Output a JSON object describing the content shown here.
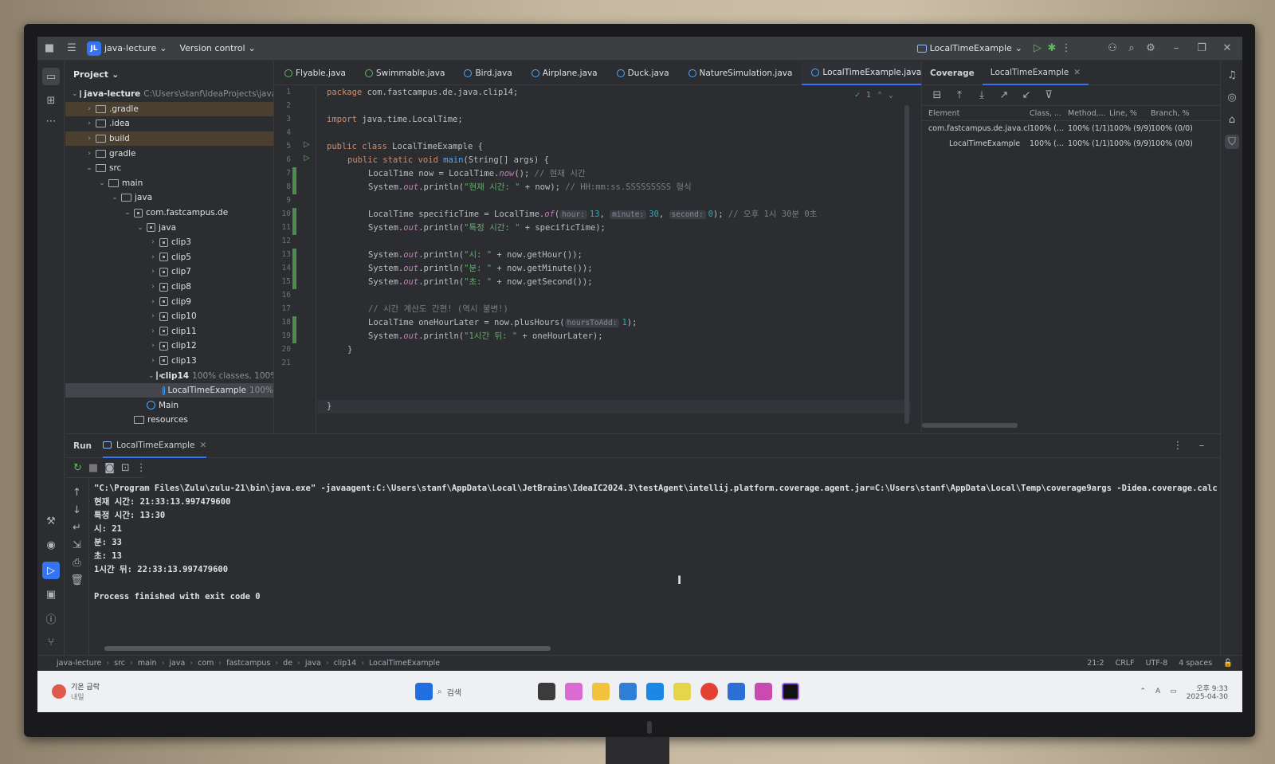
{
  "titlebar": {
    "project_badge": "JL",
    "project": "java-lecture",
    "vcs": "Version control",
    "run_config": "LocalTimeExample"
  },
  "project_panel": {
    "title": "Project",
    "root_name": "java-lecture",
    "root_path": "C:\\Users\\stanf\\IdeaProjects\\java-le",
    "items": [
      {
        "label": ".gradle",
        "note": ""
      },
      {
        "label": ".idea",
        "note": ""
      },
      {
        "label": "build",
        "note": ""
      },
      {
        "label": "gradle",
        "note": ""
      },
      {
        "label": "src",
        "note": ""
      },
      {
        "label": "main",
        "note": ""
      },
      {
        "label": "java",
        "note": ""
      },
      {
        "label": "com.fastcampus.de",
        "note": ""
      },
      {
        "label": "java",
        "note": ""
      },
      {
        "label": "clip3",
        "note": ""
      },
      {
        "label": "clip5",
        "note": ""
      },
      {
        "label": "clip7",
        "note": ""
      },
      {
        "label": "clip8",
        "note": ""
      },
      {
        "label": "clip9",
        "note": ""
      },
      {
        "label": "clip10",
        "note": ""
      },
      {
        "label": "clip11",
        "note": ""
      },
      {
        "label": "clip12",
        "note": ""
      },
      {
        "label": "clip13",
        "note": ""
      },
      {
        "label": "clip14",
        "note": "100% classes, 100% li"
      },
      {
        "label": "LocalTimeExample",
        "note": "100%"
      },
      {
        "label": "Main",
        "note": ""
      },
      {
        "label": "resources",
        "note": ""
      }
    ]
  },
  "editor_tabs": [
    "Flyable.java",
    "Swimmable.java",
    "Bird.java",
    "Airplane.java",
    "Duck.java",
    "NatureSimulation.java",
    "LocalTimeExample.java"
  ],
  "editor": {
    "inspection_count": "1",
    "line_numbers": [
      "1",
      "2",
      "3",
      "4",
      "5",
      "6",
      "7",
      "8",
      "9",
      "10",
      "11",
      "12",
      "13",
      "14",
      "15",
      "16",
      "17",
      "18",
      "19",
      "20",
      "21"
    ],
    "lines": {
      "l1_kw": "package",
      "l1_rest": " com.fastcampus.de.java.clip14;",
      "l3_kw": "import",
      "l3_rest": " java.time.LocalTime;",
      "l5_kw": "public class",
      "l5_rest": " LocalTimeExample {",
      "l6_kw": "public static void",
      "l6_fn": "main",
      "l6_rest": "(String[] args) {",
      "l7_a": "LocalTime now = LocalTime.",
      "l7_st": "now",
      "l7_b": "(); ",
      "l7_cm": "// 현재 시간",
      "l8_a": "System.",
      "l8_st": "out",
      "l8_b": ".println(",
      "l8_str": "\"현재 시간: \"",
      "l8_c": " + now); ",
      "l8_cm": "// HH:mm:ss.SSSSSSSSS 형식",
      "l10_a": "LocalTime specificTime = LocalTime.",
      "l10_st": "of",
      "l10_hint1": "hour:",
      "l10_n1": "13",
      "l10_hint2": "minute:",
      "l10_n2": "30",
      "l10_hint3": "second:",
      "l10_n3": "0",
      "l10_cm": "// 오후 1시 30분 0초",
      "l11_str": "\"특정 시간: \"",
      "l11_c": " + specificTime);",
      "l13_str": "\"시: \"",
      "l13_c": " + now.getHour());",
      "l14_str": "\"분: \"",
      "l14_c": " + now.getMinute());",
      "l15_str": "\"초: \"",
      "l15_c": " + now.getSecond());",
      "l17_cm": "// 시간 계산도 간편! (역시 불변!)",
      "l18_a": "LocalTime oneHourLater = now.plusHours(",
      "l18_hint": "hoursToAdd:",
      "l18_n": "1",
      "l18_b": ");",
      "l19_str": "\"1시간 뒤: \"",
      "l19_c": " + oneHourLater);",
      "l20": "}",
      "l21": "}"
    }
  },
  "coverage": {
    "tab_title": "Coverage",
    "tab_run": "LocalTimeExample",
    "headers": [
      "Element",
      "Class, ...",
      "Method,...",
      "Line, %",
      "Branch, %"
    ],
    "rows": [
      {
        "element": "com.fastcampus.de.java.cl",
        "class": "100% (...",
        "method": "100% (1/1)",
        "line": "100% (9/9)",
        "branch": "100% (0/0)"
      },
      {
        "element": "LocalTimeExample",
        "class": "100% (...",
        "method": "100% (1/1)",
        "line": "100% (9/9)",
        "branch": "100% (0/0)"
      }
    ]
  },
  "run_panel": {
    "title": "Run",
    "tab": "LocalTimeExample",
    "console": [
      "\"C:\\Program Files\\Zulu\\zulu-21\\bin\\java.exe\" -javaagent:C:\\Users\\stanf\\AppData\\Local\\JetBrains\\IdeaIC2024.3\\testAgent\\intellij.platform.coverage.agent.jar=C:\\Users\\stanf\\AppData\\Local\\Temp\\coverage9args -Didea.coverage.calcu",
      "현재 시간: 21:33:13.997479600",
      "특정 시간: 13:30",
      "시: 21",
      "분: 33",
      "초: 13",
      "1시간 뒤: 22:33:13.997479600",
      "",
      "Process finished with exit code 0"
    ]
  },
  "statusbar": {
    "breadcrumb": [
      "java-lecture",
      "src",
      "main",
      "java",
      "com",
      "fastcampus",
      "de",
      "java",
      "clip14",
      "LocalTimeExample"
    ],
    "position": "21:2",
    "line_sep": "CRLF",
    "encoding": "UTF-8",
    "indent": "4 spaces"
  },
  "taskbar": {
    "weather_title": "기온 급락",
    "weather_sub": "내일",
    "search": "검색",
    "time": "오후 9:33",
    "date": "2025-04-30"
  }
}
